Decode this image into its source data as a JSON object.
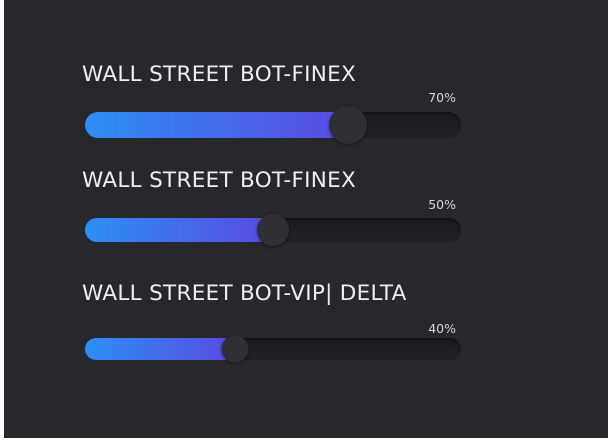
{
  "sliders": [
    {
      "label": "WALL STREET BOT-FINEX",
      "percent_text": "70%",
      "value": 0.7
    },
    {
      "label": "WALL STREET BOT-FINEX",
      "percent_text": "50%",
      "value": 0.5
    },
    {
      "label": "WALL STREET BOT-VIP| DELTA",
      "percent_text": "40%",
      "value": 0.4
    }
  ],
  "colors": {
    "panel_background": "#27282c",
    "fill_start": "#2d8ff6",
    "fill_end": "#5a49e2",
    "knob": "#2f3035",
    "label_text": "#eeeeee"
  }
}
